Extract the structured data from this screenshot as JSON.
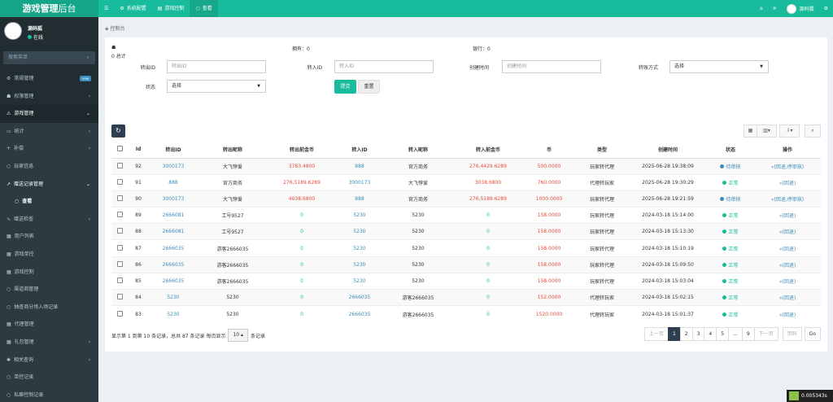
{
  "app": {
    "logo_bold": "游戏管理",
    "logo_light": "后台"
  },
  "topnav": {
    "tabs": [
      {
        "label": "系统配置"
      },
      {
        "label": "游戏控制"
      },
      {
        "label": "查看"
      }
    ],
    "user": "源码狐"
  },
  "sidebar": {
    "user_name": "源码狐",
    "status": "在线",
    "search_placeholder": "搜索菜单",
    "items": [
      {
        "label": "常规管理",
        "badge": "new"
      },
      {
        "label": "权限管理"
      },
      {
        "label": "游戏管理"
      },
      {
        "label": "统计"
      },
      {
        "label": "补偿"
      },
      {
        "label": "玩家信息"
      },
      {
        "label": "赠送记录管理"
      },
      {
        "label": "查看"
      },
      {
        "label": "赠送检查"
      },
      {
        "label": "用户列表"
      },
      {
        "label": "游戏单控"
      },
      {
        "label": "游戏控制"
      },
      {
        "label": "渠道商管理"
      },
      {
        "label": "抽查商分场入场记录"
      },
      {
        "label": "代理管理"
      },
      {
        "label": "礼包管理"
      },
      {
        "label": "相关查询"
      },
      {
        "label": "单控记录"
      },
      {
        "label": "私聊控制记录"
      }
    ]
  },
  "breadcrumb": "控制台",
  "stats": {
    "total_label": "0 总计",
    "s1": "拥有：0",
    "s2": "银行：0"
  },
  "filters": {
    "out_id_label": "转出ID",
    "out_id_ph": "转出ID",
    "in_id_label": "转入ID",
    "in_id_ph": "转入ID",
    "time_label": "创建时间",
    "time_ph": "创建时间",
    "method_label": "转账方式",
    "method_value": "选择",
    "status_label": "状态",
    "status_value": "选择",
    "submit": "提交",
    "reset": "重置"
  },
  "table": {
    "headers": [
      "Id",
      "转出ID",
      "转出昵称",
      "转出前金币",
      "转入ID",
      "转入昵称",
      "转入前金币",
      "币",
      "类型",
      "创建时间",
      "状态",
      "操作"
    ],
    "rows": [
      {
        "id": "92",
        "out_id": "3000173",
        "out_nick": "大飞悖爱",
        "out_before": "3783.4800",
        "in_id": "888",
        "in_nick": "官方商务",
        "in_before": "276,4429.6289",
        "coin": "500.0000",
        "type": "玩家转代理",
        "time": "2025-06-28 19:38:09",
        "status": "待审核",
        "status_color": "#3c8dbc",
        "op": "回退,停审核"
      },
      {
        "id": "91",
        "out_id": "888",
        "out_nick": "官方商务",
        "out_before": "276,5189.6289",
        "in_id": "3000173",
        "in_nick": "大飞悖爱",
        "in_before": "3038.6800",
        "coin": "760.0000",
        "type": "代理转玩家",
        "time": "2025-06-28 19:30:29",
        "status": "正常",
        "status_color": "#18bc9c",
        "op": "回退"
      },
      {
        "id": "90",
        "out_id": "3000173",
        "out_nick": "大飞悖爱",
        "out_before": "4038.6800",
        "in_id": "888",
        "in_nick": "官方商务",
        "in_before": "276,5189.6289",
        "coin": "1000.0000",
        "type": "玩家转代理",
        "time": "2025-06-28 19:21:59",
        "status": "待审核",
        "status_color": "#3c8dbc",
        "op": "回退,停审核"
      },
      {
        "id": "89",
        "out_id": "2666081",
        "out_nick": "工号9527",
        "out_before": "0",
        "in_id": "5230",
        "in_nick": "5230",
        "in_before": "0",
        "coin": "158.0000",
        "type": "玩家转代理",
        "time": "2024-03-18 15:14:00",
        "status": "正常",
        "status_color": "#18bc9c",
        "op": "回退"
      },
      {
        "id": "88",
        "out_id": "2666081",
        "out_nick": "工号9527",
        "out_before": "0",
        "in_id": "5230",
        "in_nick": "5230",
        "in_before": "0",
        "coin": "158.0000",
        "type": "玩家转代理",
        "time": "2024-03-18 15:13:30",
        "status": "正常",
        "status_color": "#18bc9c",
        "op": "回退"
      },
      {
        "id": "87",
        "out_id": "2666035",
        "out_nick": "游客2666035",
        "out_before": "0",
        "in_id": "5230",
        "in_nick": "5230",
        "in_before": "0",
        "coin": "158.0000",
        "type": "玩家转代理",
        "time": "2024-03-18 15:10:19",
        "status": "正常",
        "status_color": "#18bc9c",
        "op": "回退"
      },
      {
        "id": "86",
        "out_id": "2666035",
        "out_nick": "游客2666035",
        "out_before": "0",
        "in_id": "5230",
        "in_nick": "5230",
        "in_before": "0",
        "coin": "158.0000",
        "type": "玩家转代理",
        "time": "2024-03-18 15:09:50",
        "status": "正常",
        "status_color": "#18bc9c",
        "op": "回退"
      },
      {
        "id": "85",
        "out_id": "2666035",
        "out_nick": "游客2666035",
        "out_before": "0",
        "in_id": "5230",
        "in_nick": "5230",
        "in_before": "0",
        "coin": "158.0000",
        "type": "玩家转代理",
        "time": "2024-03-18 15:03:04",
        "status": "正常",
        "status_color": "#18bc9c",
        "op": "回退"
      },
      {
        "id": "84",
        "out_id": "5230",
        "out_nick": "5230",
        "out_before": "0",
        "in_id": "2666035",
        "in_nick": "游客2666035",
        "in_before": "0",
        "coin": "152.0000",
        "type": "代理转玩家",
        "time": "2024-03-18 15:02:15",
        "status": "正常",
        "status_color": "#18bc9c",
        "op": "回退"
      },
      {
        "id": "83",
        "out_id": "5230",
        "out_nick": "5230",
        "out_before": "0",
        "in_id": "2666035",
        "in_nick": "游客2666035",
        "in_before": "0",
        "coin": "1520.0000",
        "type": "代理转玩家",
        "time": "2024-03-18 15:01:37",
        "status": "正常",
        "status_color": "#18bc9c",
        "op": "回退"
      }
    ]
  },
  "footer": {
    "info_a": "显示第 1 到第 10 条记录，总共 87 条记录 每页显示",
    "page_size": "10",
    "info_b": "条记录"
  },
  "pager": {
    "prev": "上一页",
    "pages": [
      "1",
      "2",
      "3",
      "4",
      "5",
      "...",
      "9"
    ],
    "next": "下一页",
    "jump_ph": "页码",
    "go": "Go"
  },
  "timer": "0.005343s"
}
